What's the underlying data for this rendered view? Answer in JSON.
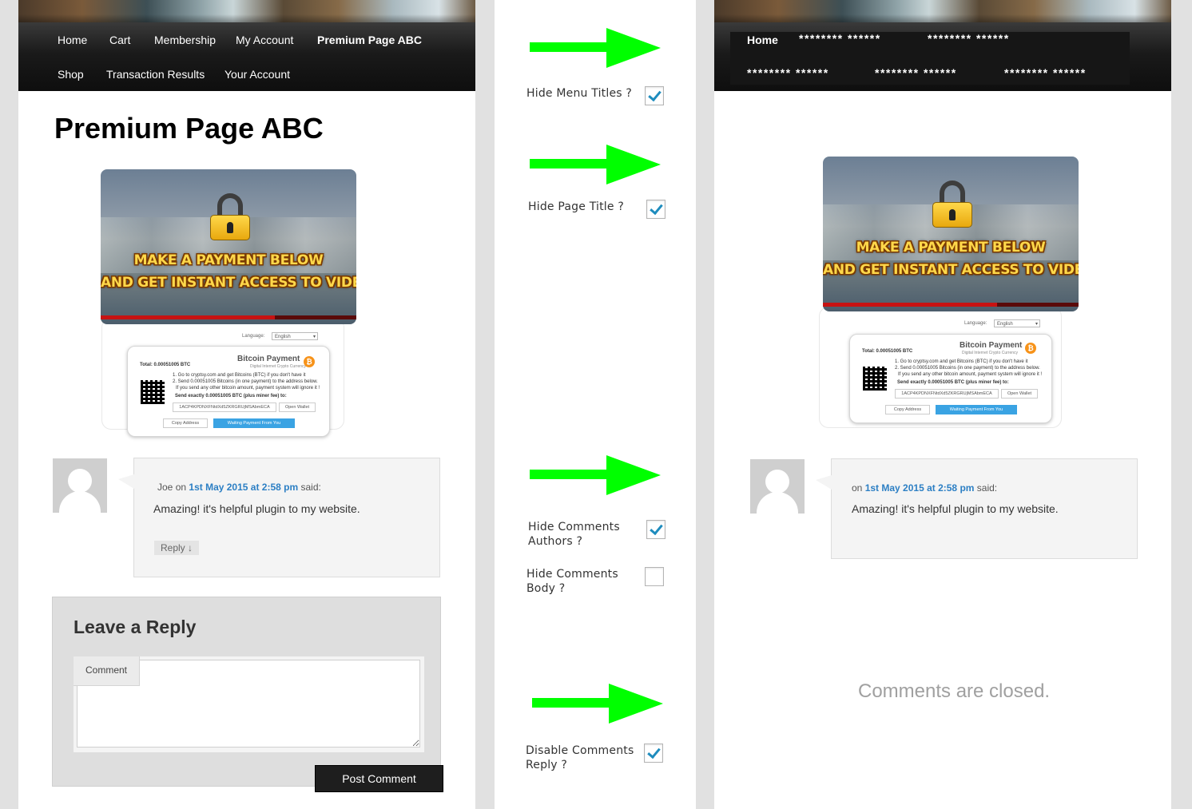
{
  "left": {
    "nav": {
      "row1": [
        "Home",
        "Cart",
        "Membership",
        "My Account",
        "Premium Page ABC"
      ],
      "row2": [
        "Shop",
        "Transaction Results",
        "Your Account"
      ]
    },
    "page_title": "Premium Page ABC",
    "video": {
      "line1": "MAKE A PAYMENT BELOW",
      "line2": "AND  GET INSTANT ACCESS TO VIDEO",
      "progress": 0.68
    },
    "payment": {
      "language_label": "Language:",
      "language_value": "English",
      "title": "Bitcoin Payment",
      "subtitle": "Digital Internet Crypto Currency",
      "coin": "₿",
      "total": "Total: 0.00051005 BTC",
      "step1": "1. Go to cryptsy.com and get Bitcoins (BTC) if you don't have it",
      "step2": "2. Send 0.00051005 Bitcoins (in one payment) to the address below.",
      "step3": "If you send any other bitcoin amount, payment system will ignore it !",
      "send_exact": "Send exactly 0.00051005 BTC (plus miner fee) to:",
      "address": "1ACP4KPDNXFNtdXd5ZKRGRUjMSAbmECA",
      "open_wallet": "Open Wallet",
      "copy_address": "Copy Address",
      "waiting": "Waiting Payment From You"
    },
    "comment": {
      "author": "Joe",
      "on": "on",
      "date": "1st May 2015 at 2:58 pm",
      "said": "said:",
      "body": "Amazing! it's helpful plugin to my website.",
      "reply": "Reply ↓"
    },
    "reply_form": {
      "heading": "Leave a Reply",
      "comment_label": "Comment",
      "post_button": "Post Comment"
    }
  },
  "middle": {
    "options": [
      {
        "label_lines": [
          "Hide Menu Titles ?"
        ],
        "checked": true
      },
      {
        "label_lines": [
          "Hide Page Title ?"
        ],
        "checked": true
      },
      {
        "label_lines": [
          "Hide Comments",
          "Authors ?"
        ],
        "checked": true
      },
      {
        "label_lines": [
          "Hide Comments",
          "Body ?"
        ],
        "checked": false
      },
      {
        "label_lines": [
          "Disable Comments",
          "Reply ?"
        ],
        "checked": true
      }
    ],
    "arrow_color": "#00ff00"
  },
  "right": {
    "nav": {
      "home": "Home",
      "masked": [
        "******** ******",
        "******** ******",
        "******** ******",
        "******** ******",
        "******** ******"
      ]
    },
    "comment": {
      "on": "on",
      "date": "1st May 2015 at 2:58 pm",
      "said": "said:",
      "body": "Amazing! it's helpful plugin to my website."
    },
    "closed_text": "Comments are closed."
  }
}
